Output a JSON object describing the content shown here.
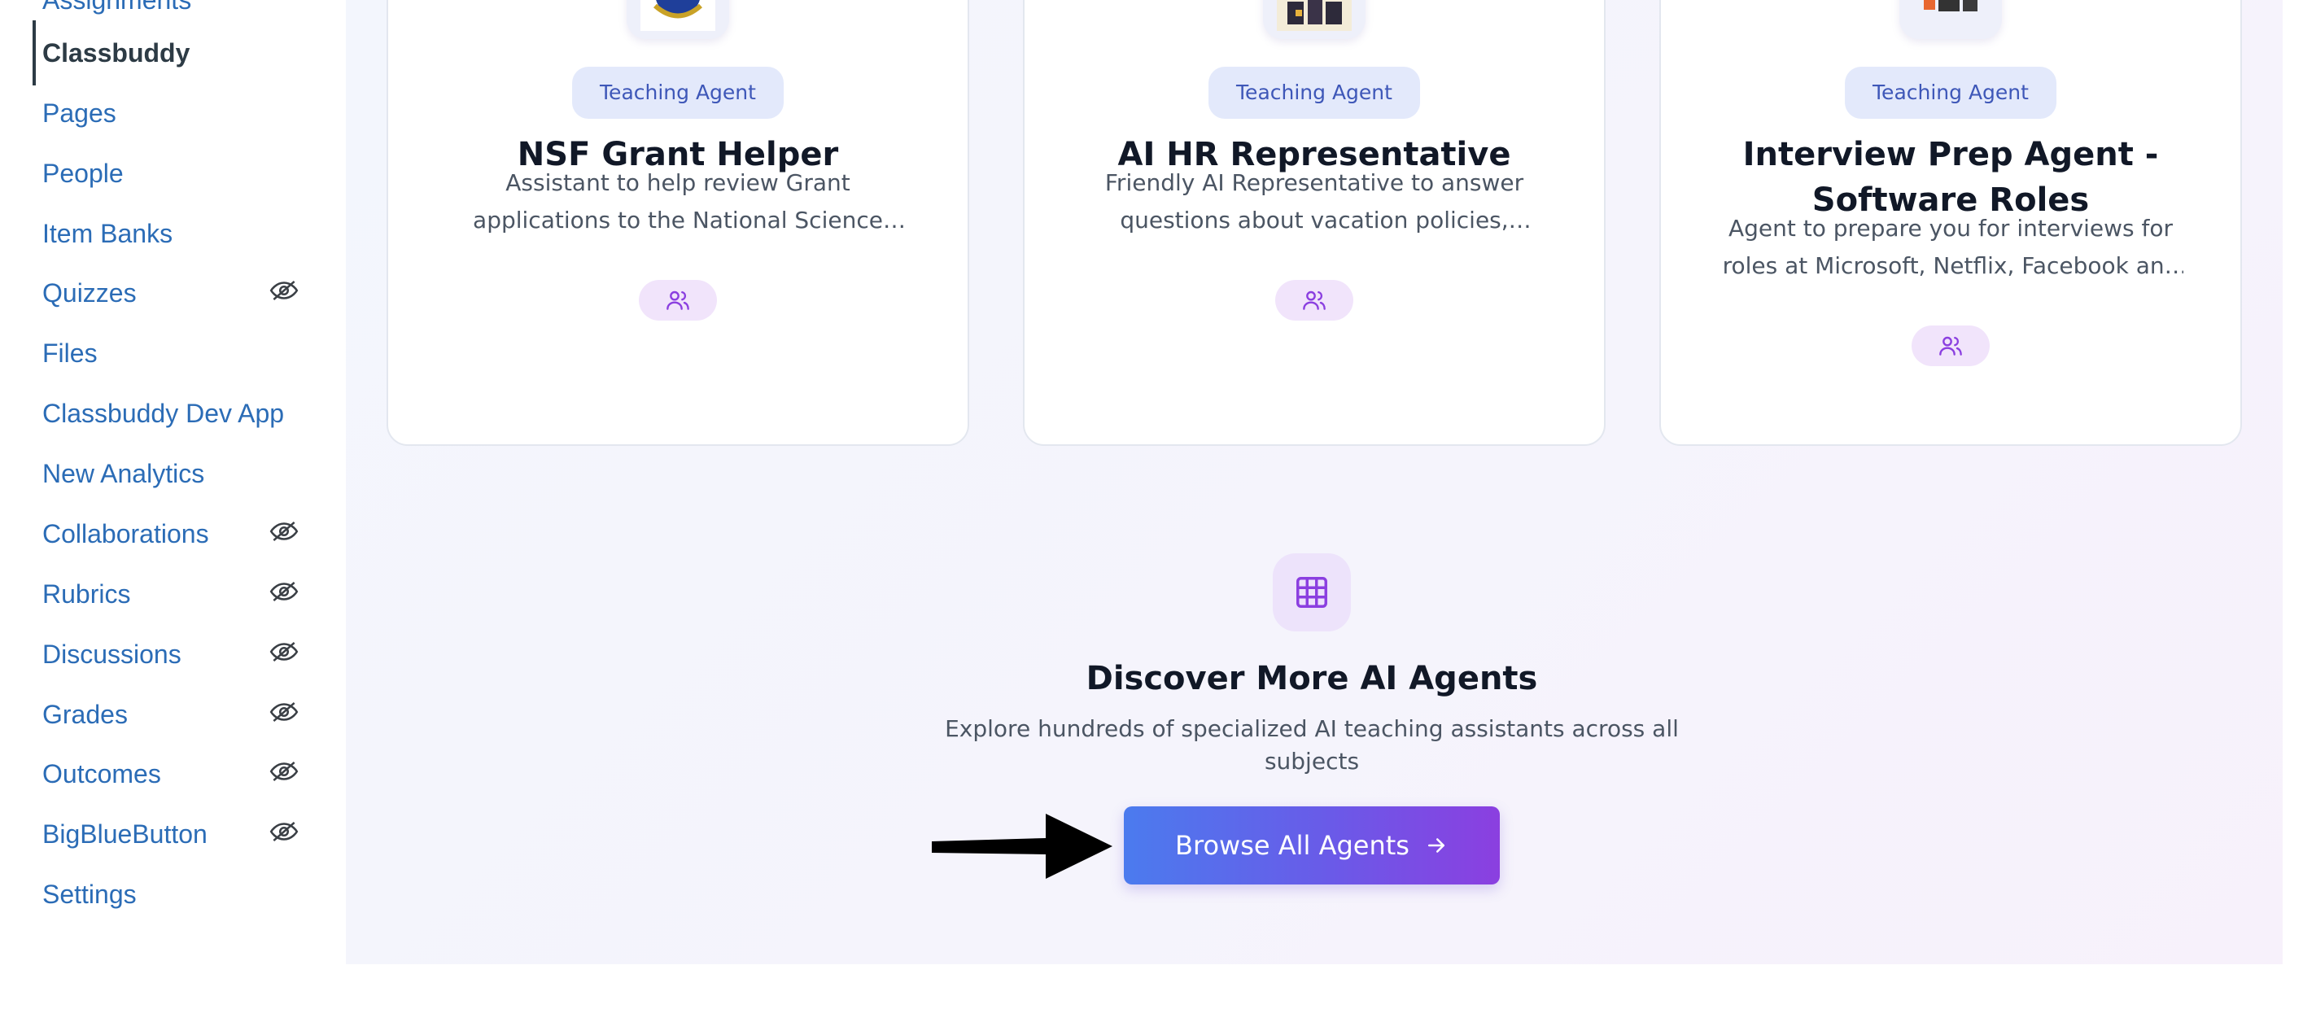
{
  "sidebar": {
    "items": [
      {
        "label": "Assignments",
        "hidden": false,
        "active": false
      },
      {
        "label": "Classbuddy",
        "hidden": false,
        "active": true
      },
      {
        "label": "Pages",
        "hidden": false,
        "active": false
      },
      {
        "label": "People",
        "hidden": false,
        "active": false
      },
      {
        "label": "Item Banks",
        "hidden": false,
        "active": false
      },
      {
        "label": "Quizzes",
        "hidden": true,
        "active": false
      },
      {
        "label": "Files",
        "hidden": false,
        "active": false
      },
      {
        "label": "Classbuddy Dev App",
        "hidden": false,
        "active": false
      },
      {
        "label": "New Analytics",
        "hidden": false,
        "active": false
      },
      {
        "label": "Collaborations",
        "hidden": true,
        "active": false
      },
      {
        "label": "Rubrics",
        "hidden": true,
        "active": false
      },
      {
        "label": "Discussions",
        "hidden": true,
        "active": false
      },
      {
        "label": "Grades",
        "hidden": true,
        "active": false
      },
      {
        "label": "Outcomes",
        "hidden": true,
        "active": false
      },
      {
        "label": "BigBlueButton",
        "hidden": true,
        "active": false
      },
      {
        "label": "Settings",
        "hidden": false,
        "active": false
      }
    ]
  },
  "cards": [
    {
      "badge": "Teaching Agent",
      "title": "NSF Grant Helper",
      "description": "Assistant to help review Grant applications to the National Science Foundation for compliance and quality."
    },
    {
      "badge": "Teaching Agent",
      "title": "AI HR Representative",
      "description": "Friendly AI Representative to answer questions about vacation policies, benefits and more."
    },
    {
      "badge": "Teaching Agent",
      "title": "Interview Prep Agent - Software Roles",
      "description": "Agent to prepare you for interviews for roles at Microsoft, Netflix, Facebook and more."
    }
  ],
  "discover": {
    "title": "Discover More AI Agents",
    "subtitle": "Explore hundreds of specialized AI teaching assistants across all subjects",
    "button_label": "Browse All Agents",
    "button_icon": "arrow-right-icon",
    "icon": "grid-icon"
  },
  "colors": {
    "link": "#2b6cb6",
    "accent_start": "#4b7bee",
    "accent_end": "#8b3fe0",
    "badge_bg": "#e3e9fb",
    "icon_purple": "#8b3fe0"
  }
}
